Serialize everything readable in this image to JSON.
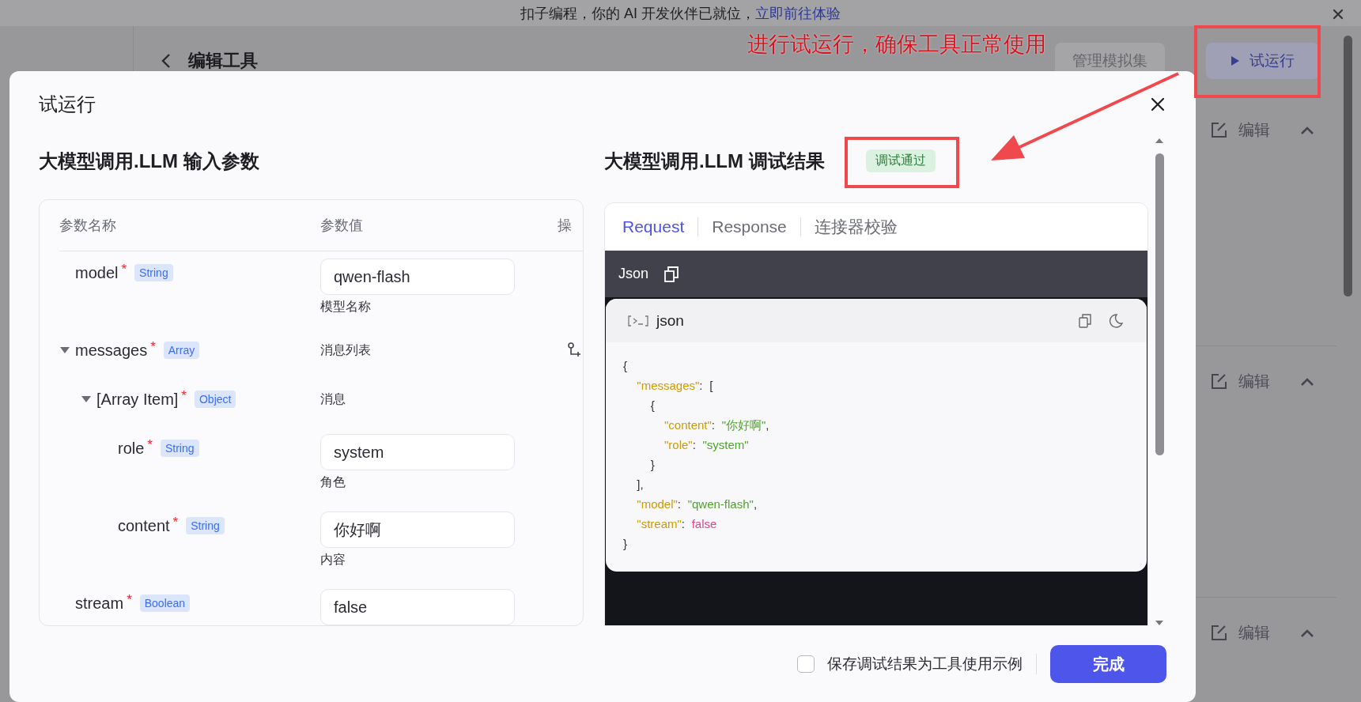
{
  "banner": {
    "text": "扣子编程，你的 AI 开发伙伴已就位，",
    "link": "立即前往体验"
  },
  "page": {
    "title": "编辑工具",
    "buttons": [
      {
        "label": "管理模拟集",
        "kind": "secondary"
      },
      {
        "label": "试运行",
        "kind": "primary"
      }
    ],
    "sections": [
      {
        "action": "编辑",
        "expanded": true
      },
      {
        "action": "编辑",
        "expanded": true
      },
      {
        "action": "编辑",
        "expanded": true
      }
    ]
  },
  "modal": {
    "title": "试运行",
    "input": {
      "heading": "大模型调用.LLM 输入参数",
      "columns": [
        "参数名称",
        "参数值",
        "操"
      ],
      "params": [
        {
          "name": "model",
          "required_mark": "*",
          "type": "String",
          "value": "qwen-flash",
          "description": "模型名称",
          "can_add": false
        },
        {
          "name": "messages",
          "required_mark": "*",
          "type": "Array",
          "description": "消息列表",
          "can_add": true,
          "expanded": true,
          "children": [
            {
              "name": "[Array Item]",
              "required_mark": "*",
              "type": "Object",
              "description": "消息",
              "can_add": false,
              "expanded": true,
              "children": [
                {
                  "name": "role",
                  "required_mark": "*",
                  "type": "String",
                  "value": "system",
                  "description": "角色",
                  "can_add": false
                },
                {
                  "name": "content",
                  "required_mark": "*",
                  "type": "String",
                  "value": "你好啊",
                  "description": "内容",
                  "can_add": false
                }
              ]
            }
          ]
        },
        {
          "name": "stream",
          "required_mark": "*",
          "type": "Boolean",
          "value": "false",
          "can_add": false
        }
      ]
    },
    "result": {
      "heading": "大模型调用.LLM 调试结果",
      "status": "调试通过",
      "tabs": [
        {
          "label": "Request",
          "selected": true
        },
        {
          "label": "Response",
          "selected": false
        },
        {
          "label": "连接器校验",
          "selected": false
        }
      ],
      "format": "Json",
      "language": "json",
      "lines": [
        [
          {
            "kind": "punct",
            "text": "{"
          }
        ],
        [
          {
            "kind": "key",
            "text": "  \"messages\""
          },
          {
            "kind": "punct",
            "text": ": ["
          }
        ],
        [
          {
            "kind": "punct",
            "text": "    {"
          }
        ],
        [
          {
            "kind": "key",
            "text": "      \"content\""
          },
          {
            "kind": "punct",
            "text": ": "
          },
          {
            "kind": "string",
            "text": "\"你好啊\""
          },
          {
            "kind": "punct",
            "text": ","
          }
        ],
        [
          {
            "kind": "key",
            "text": "      \"role\""
          },
          {
            "kind": "punct",
            "text": ": "
          },
          {
            "kind": "string",
            "text": "\"system\""
          }
        ],
        [
          {
            "kind": "punct",
            "text": "    }"
          }
        ],
        [
          {
            "kind": "punct",
            "text": "  ],"
          }
        ],
        [
          {
            "kind": "key",
            "text": "  \"model\""
          },
          {
            "kind": "punct",
            "text": ": "
          },
          {
            "kind": "string",
            "text": "\"qwen-flash\""
          },
          {
            "kind": "punct",
            "text": ","
          }
        ],
        [
          {
            "kind": "key",
            "text": "  \"stream\""
          },
          {
            "kind": "punct",
            "text": ": "
          },
          {
            "kind": "bool",
            "text": "false"
          }
        ],
        [
          {
            "kind": "punct",
            "text": "}"
          }
        ]
      ]
    },
    "footer": {
      "save_example": {
        "label": "保存调试结果为工具使用示例",
        "checked": false
      },
      "done": "完成"
    }
  },
  "annotation": {
    "text": "进行试运行，确保工具正常使用"
  }
}
